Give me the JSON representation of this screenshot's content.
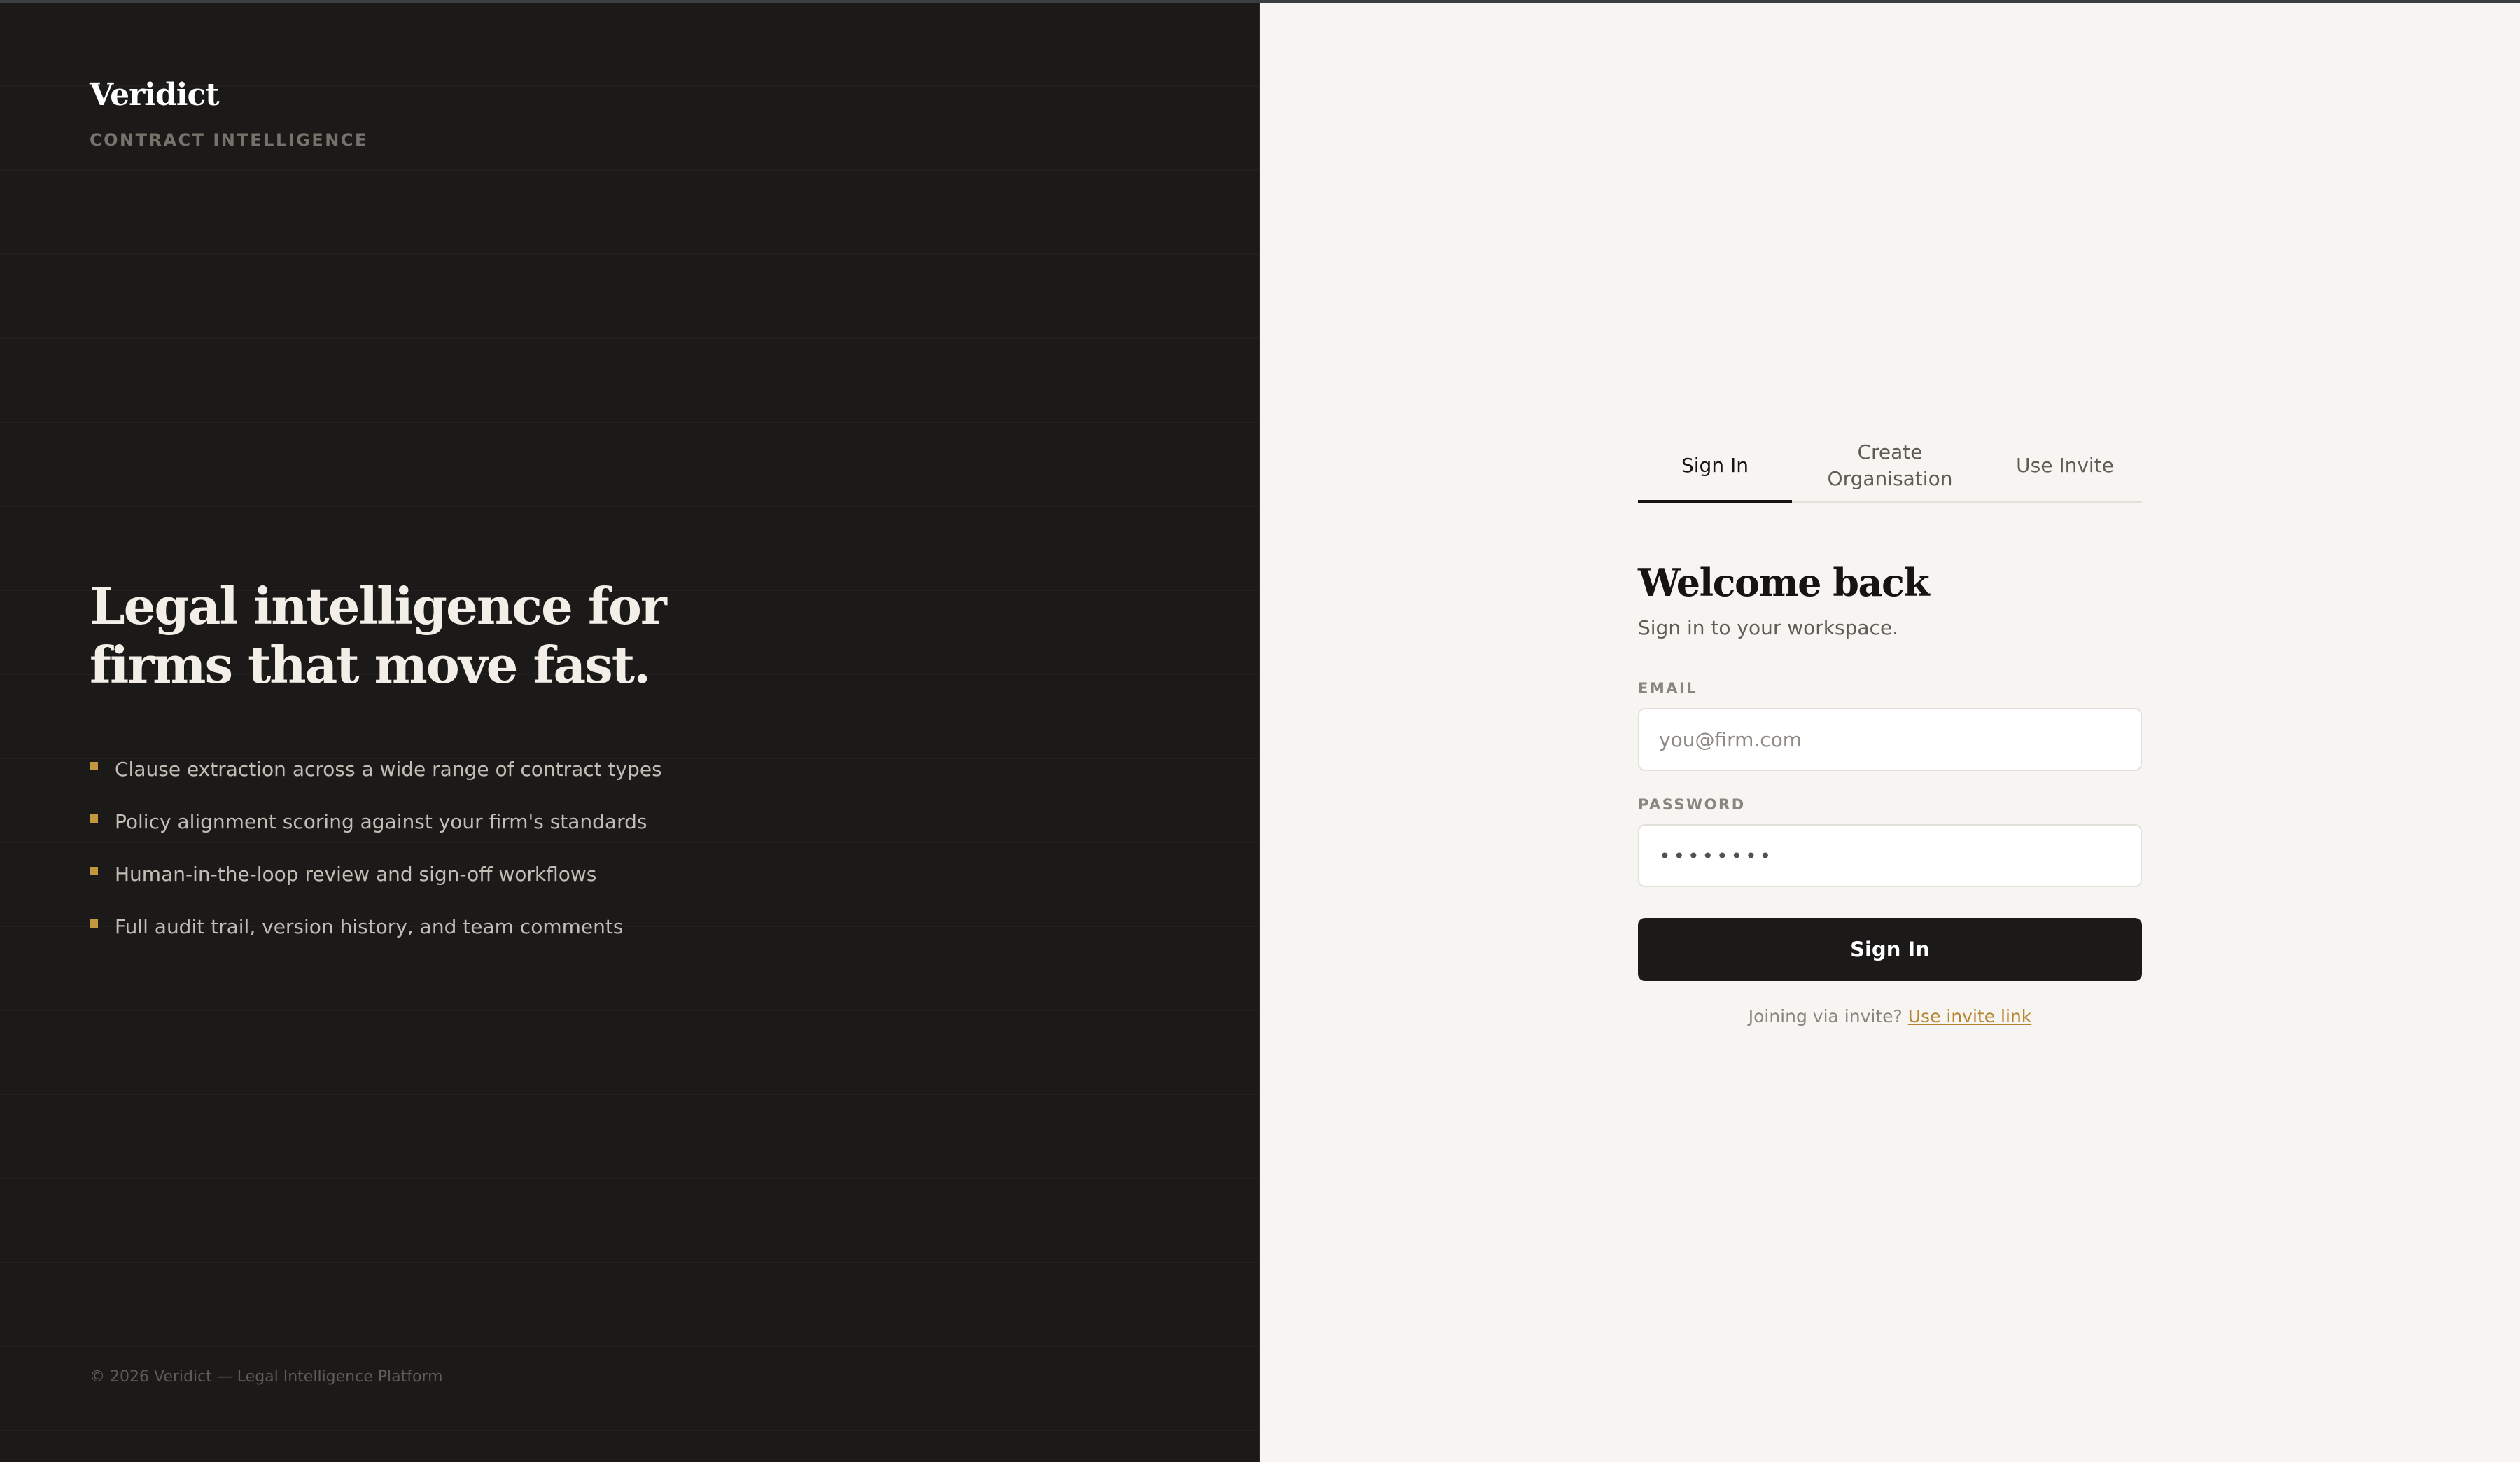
{
  "brand": {
    "name": "Veridict",
    "tagline": "CONTRACT INTELLIGENCE"
  },
  "hero": {
    "headline_line1": "Legal intelligence for",
    "headline_line2": "firms that move fast.",
    "features": [
      "Clause extraction across a wide range of contract types",
      "Policy alignment scoring against your firm's standards",
      "Human-in-the-loop review and sign-off workflows",
      "Full audit trail, version history, and team comments"
    ],
    "footer": "© 2026 Veridict — Legal Intelligence Platform"
  },
  "auth": {
    "tabs": [
      {
        "label": "Sign In",
        "active": true
      },
      {
        "label": "Create Organisation",
        "active": false
      },
      {
        "label": "Use Invite",
        "active": false
      }
    ],
    "title": "Welcome back",
    "subtitle": "Sign in to your workspace.",
    "email": {
      "label": "EMAIL",
      "placeholder": "you@firm.com",
      "value": ""
    },
    "password": {
      "label": "PASSWORD",
      "value": "••••••••"
    },
    "submit_label": "Sign In",
    "invite_prompt": "Joining via invite?",
    "invite_link": "Use invite link"
  },
  "colors": {
    "left_panel_bg": "#1b1a19",
    "right_panel_bg": "#f6f5f2",
    "accent_gold": "#c4973f",
    "button_dark": "#1b1a19"
  }
}
